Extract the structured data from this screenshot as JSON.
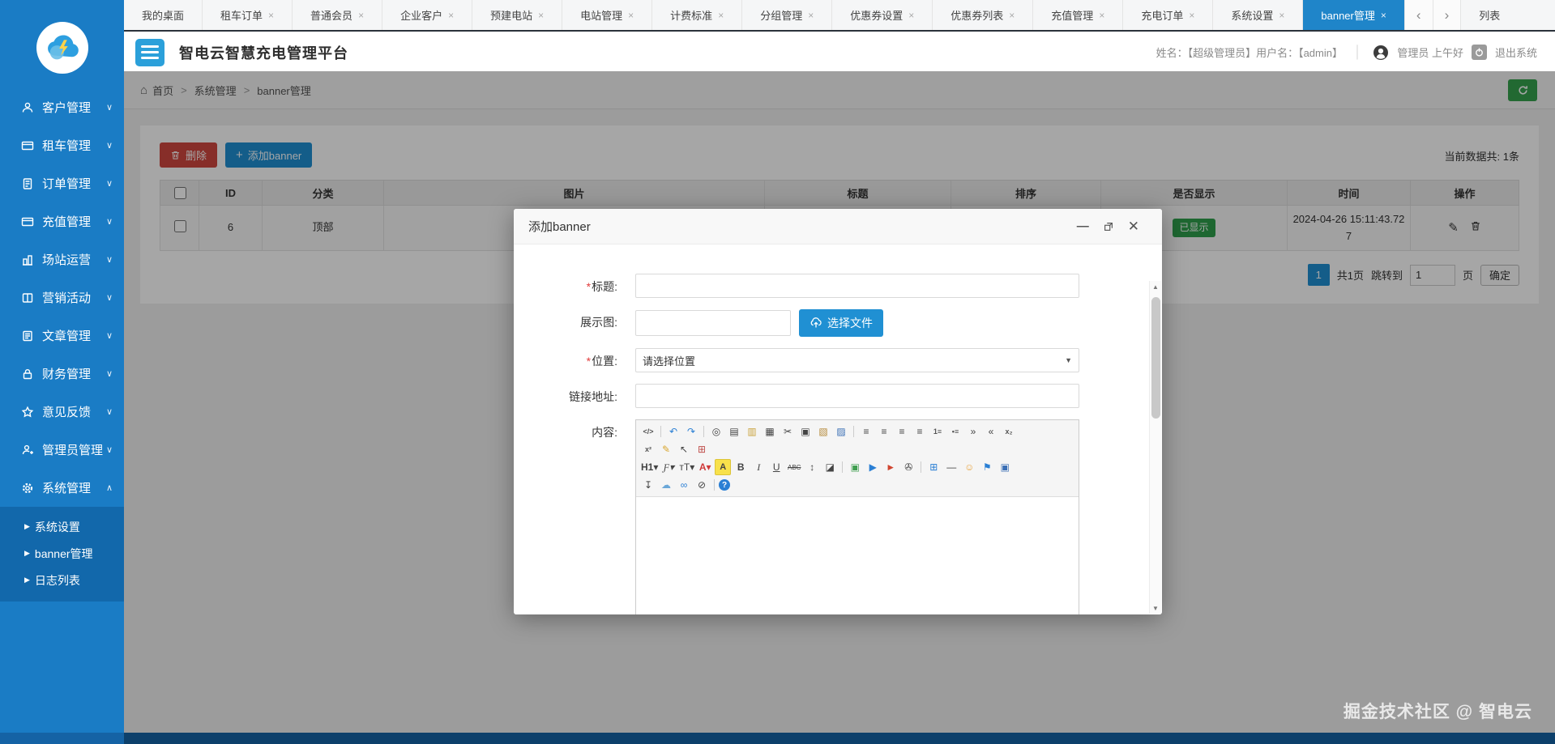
{
  "colors": {
    "sidebar": "#1a7cc5",
    "subnav": "#1268ab",
    "activetab": "#1f85c9",
    "accent": "#2090d3",
    "danger": "#d0473f",
    "success": "#35a14e",
    "badge": "#2f9e4c"
  },
  "tabs": {
    "items": [
      {
        "label": "我的桌面",
        "closable": false,
        "active": false
      },
      {
        "label": "租车订单",
        "closable": true,
        "active": false
      },
      {
        "label": "普通会员",
        "closable": true,
        "active": false
      },
      {
        "label": "企业客户",
        "closable": true,
        "active": false
      },
      {
        "label": "预建电站",
        "closable": true,
        "active": false
      },
      {
        "label": "电站管理",
        "closable": true,
        "active": false
      },
      {
        "label": "计费标准",
        "closable": true,
        "active": false
      },
      {
        "label": "分组管理",
        "closable": true,
        "active": false
      },
      {
        "label": "优惠券设置",
        "closable": true,
        "active": false
      },
      {
        "label": "优惠券列表",
        "closable": true,
        "active": false
      },
      {
        "label": "充值管理",
        "closable": true,
        "active": false
      },
      {
        "label": "充电订单",
        "closable": true,
        "active": false
      },
      {
        "label": "系统设置",
        "closable": true,
        "active": false
      },
      {
        "label": "banner管理",
        "closable": true,
        "active": true
      }
    ],
    "nav_prev": "‹",
    "nav_next": "›",
    "overflow_label": "列表"
  },
  "header": {
    "title": "智电云智慧充电管理平台",
    "user_info": "姓名：【超级管理员】用户名：【admin】",
    "greeting": "管理员 上午好",
    "logout_label": "退出系统"
  },
  "sidebar": {
    "items": [
      {
        "label": "客户管理",
        "icon": "user",
        "chevron": "down"
      },
      {
        "label": "租车管理",
        "icon": "card",
        "chevron": "down"
      },
      {
        "label": "订单管理",
        "icon": "order",
        "chevron": "down"
      },
      {
        "label": "充值管理",
        "icon": "card",
        "chevron": "down"
      },
      {
        "label": "场站运营",
        "icon": "station",
        "chevron": "down"
      },
      {
        "label": "营销活动",
        "icon": "book",
        "chevron": "down"
      },
      {
        "label": "文章管理",
        "icon": "article",
        "chevron": "down"
      },
      {
        "label": "财务管理",
        "icon": "lock",
        "chevron": "down"
      },
      {
        "label": "意见反馈",
        "icon": "star",
        "chevron": "down"
      },
      {
        "label": "管理员管理",
        "icon": "admin",
        "chevron": "down"
      },
      {
        "label": "系统管理",
        "icon": "gear",
        "chevron": "up",
        "expanded": true
      }
    ],
    "submenu": [
      "系统设置",
      "banner管理",
      "日志列表"
    ]
  },
  "breadcrumb": {
    "home": "首页",
    "level2": "系统管理",
    "level3": "banner管理"
  },
  "toolbar": {
    "delete_label": "删除",
    "add_label": "添加banner",
    "count_label": "当前数据共: 1条"
  },
  "table": {
    "headers": [
      "ID",
      "分类",
      "图片",
      "标题",
      "排序",
      "是否显示",
      "时间",
      "操作"
    ],
    "row": {
      "id": "6",
      "category": "顶部",
      "image": "",
      "title": "",
      "sort": "",
      "visible_badge": "已显示",
      "time": "2024-04-26 15:11:43.727"
    }
  },
  "pagination": {
    "page": "1",
    "total_label": "共1页",
    "jump_label": "跳转到",
    "jump_value": "1",
    "unit_label": "页",
    "confirm_label": "确定"
  },
  "modal": {
    "title": "添加banner",
    "title_label": "标题",
    "image_label": "展示图",
    "choose_file_label": "选择文件",
    "position_label": "位置",
    "position_value": "请选择位置",
    "link_label": "链接地址",
    "content_label": "内容"
  },
  "editor": {
    "rows": [
      [
        {
          "n": "source",
          "g": "</>",
          "cls": "tb-sm"
        },
        {
          "sep": true
        },
        {
          "n": "undo",
          "g": "↶",
          "c": "#2a7fd4"
        },
        {
          "n": "redo",
          "g": "↷",
          "c": "#2a7fd4"
        },
        {
          "sep": true
        },
        {
          "n": "preview",
          "g": "◎"
        },
        {
          "n": "print",
          "g": "▤"
        },
        {
          "n": "template",
          "g": "▥",
          "c": "#c9a23c"
        },
        {
          "n": "code-view",
          "g": "▦"
        },
        {
          "n": "cut",
          "g": "✂"
        },
        {
          "n": "copy",
          "g": "▣"
        },
        {
          "n": "paste",
          "g": "▧",
          "c": "#b58a3a"
        },
        {
          "n": "paste-word",
          "g": "▨",
          "c": "#3a6fb5"
        },
        {
          "sep": true
        },
        {
          "n": "align-left",
          "g": "≡"
        },
        {
          "n": "align-center",
          "g": "≡"
        },
        {
          "n": "align-right",
          "g": "≡"
        },
        {
          "n": "align-justify",
          "g": "≡"
        },
        {
          "n": "ordered-list",
          "g": "1≡",
          "cls": "tb-sm"
        },
        {
          "n": "unordered-list",
          "g": "•≡",
          "cls": "tb-sm"
        },
        {
          "n": "indent",
          "g": "»"
        },
        {
          "n": "outdent",
          "g": "«"
        },
        {
          "n": "subscript",
          "g": "x₂",
          "cls": "tb-sm"
        }
      ],
      [
        {
          "n": "superscript",
          "g": "x²",
          "cls": "tb-sm"
        },
        {
          "n": "format-brush",
          "g": "✎",
          "c": "#d9a62e"
        },
        {
          "n": "select-all",
          "g": "↖"
        },
        {
          "n": "quick-format",
          "g": "⊞",
          "c": "#c0504d"
        }
      ],
      [
        {
          "n": "heading",
          "g": "H1▾",
          "cls": "tb-b"
        },
        {
          "n": "font-name",
          "g": "Ƒ▾",
          "cls": "tb-i"
        },
        {
          "n": "font-size",
          "g": "тT▾"
        },
        {
          "n": "fore-color",
          "g": "A▾",
          "c": "#d03a3a",
          "cls": "tb-b"
        },
        {
          "n": "hilite-color",
          "g": "A",
          "cls": "tb-hl"
        },
        {
          "n": "bold",
          "g": "B",
          "cls": "tb-b"
        },
        {
          "n": "italic",
          "g": "I",
          "cls": "tb-i"
        },
        {
          "n": "underline",
          "g": "U",
          "cls": "tb-u"
        },
        {
          "n": "strikethrough",
          "g": "ABC",
          "cls": "tb-st"
        },
        {
          "n": "line-height",
          "g": "↕"
        },
        {
          "n": "remove-format",
          "g": "◪"
        },
        {
          "sep": true
        },
        {
          "n": "image",
          "g": "▣",
          "c": "#3f9e4f"
        },
        {
          "n": "flash",
          "g": "▶",
          "c": "#2a7fd4"
        },
        {
          "n": "media",
          "g": "►",
          "c": "#d0452f"
        },
        {
          "n": "insert-file",
          "g": "✇"
        },
        {
          "sep": true
        },
        {
          "n": "table",
          "g": "⊞",
          "c": "#2a7fd4"
        },
        {
          "n": "hr",
          "g": "―"
        },
        {
          "n": "emoticons",
          "g": "☺",
          "c": "#e8a33d"
        },
        {
          "n": "map",
          "g": "⚑",
          "c": "#2a7fd4"
        },
        {
          "n": "media-image",
          "g": "▣",
          "c": "#3a6fb5"
        }
      ],
      [
        {
          "n": "anchor",
          "g": "↧"
        },
        {
          "n": "cloud-upload",
          "g": "☁",
          "c": "#6aa7d8"
        },
        {
          "n": "link",
          "g": "∞",
          "c": "#2a7fd4"
        },
        {
          "n": "unlink",
          "g": "⊘"
        },
        {
          "sep": true
        },
        {
          "n": "about",
          "g": "?",
          "cls": "tb-round"
        }
      ]
    ]
  },
  "watermark": {
    "text": "掘金技术社区 @ 智电云"
  }
}
